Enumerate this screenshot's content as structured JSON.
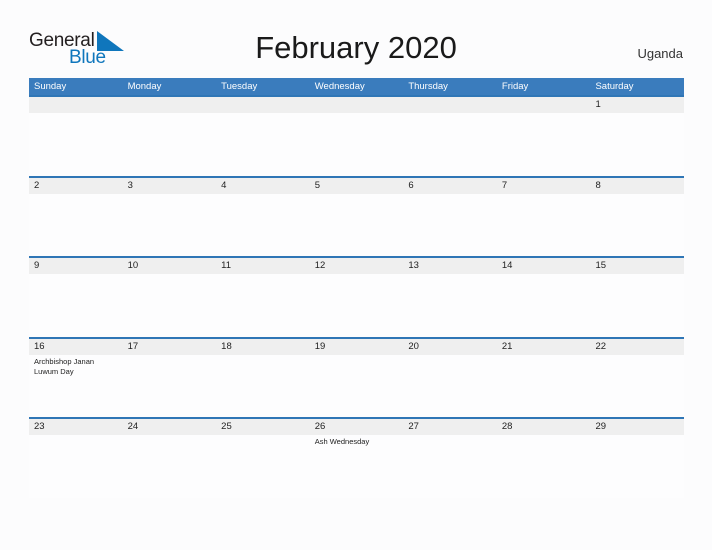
{
  "brand": {
    "name_part1": "General",
    "name_part2": "Blue",
    "flag_icon": "triangle-flag-icon",
    "color_primary": "#0f76bc",
    "color_text": "#231f20"
  },
  "header": {
    "title": "February 2020",
    "country": "Uganda"
  },
  "calendar": {
    "accent_color": "#3a7cbd",
    "row_line_color": "#2f76b6",
    "date_band_color": "#efefef",
    "weekdays": [
      "Sunday",
      "Monday",
      "Tuesday",
      "Wednesday",
      "Thursday",
      "Friday",
      "Saturday"
    ],
    "weeks": [
      [
        {
          "day": "",
          "event": ""
        },
        {
          "day": "",
          "event": ""
        },
        {
          "day": "",
          "event": ""
        },
        {
          "day": "",
          "event": ""
        },
        {
          "day": "",
          "event": ""
        },
        {
          "day": "",
          "event": ""
        },
        {
          "day": "1",
          "event": ""
        }
      ],
      [
        {
          "day": "2",
          "event": ""
        },
        {
          "day": "3",
          "event": ""
        },
        {
          "day": "4",
          "event": ""
        },
        {
          "day": "5",
          "event": ""
        },
        {
          "day": "6",
          "event": ""
        },
        {
          "day": "7",
          "event": ""
        },
        {
          "day": "8",
          "event": ""
        }
      ],
      [
        {
          "day": "9",
          "event": ""
        },
        {
          "day": "10",
          "event": ""
        },
        {
          "day": "11",
          "event": ""
        },
        {
          "day": "12",
          "event": ""
        },
        {
          "day": "13",
          "event": ""
        },
        {
          "day": "14",
          "event": ""
        },
        {
          "day": "15",
          "event": ""
        }
      ],
      [
        {
          "day": "16",
          "event": "Archbishop Janan Luwum Day"
        },
        {
          "day": "17",
          "event": ""
        },
        {
          "day": "18",
          "event": ""
        },
        {
          "day": "19",
          "event": ""
        },
        {
          "day": "20",
          "event": ""
        },
        {
          "day": "21",
          "event": ""
        },
        {
          "day": "22",
          "event": ""
        }
      ],
      [
        {
          "day": "23",
          "event": ""
        },
        {
          "day": "24",
          "event": ""
        },
        {
          "day": "25",
          "event": ""
        },
        {
          "day": "26",
          "event": "Ash Wednesday"
        },
        {
          "day": "27",
          "event": ""
        },
        {
          "day": "28",
          "event": ""
        },
        {
          "day": "29",
          "event": ""
        }
      ]
    ]
  }
}
